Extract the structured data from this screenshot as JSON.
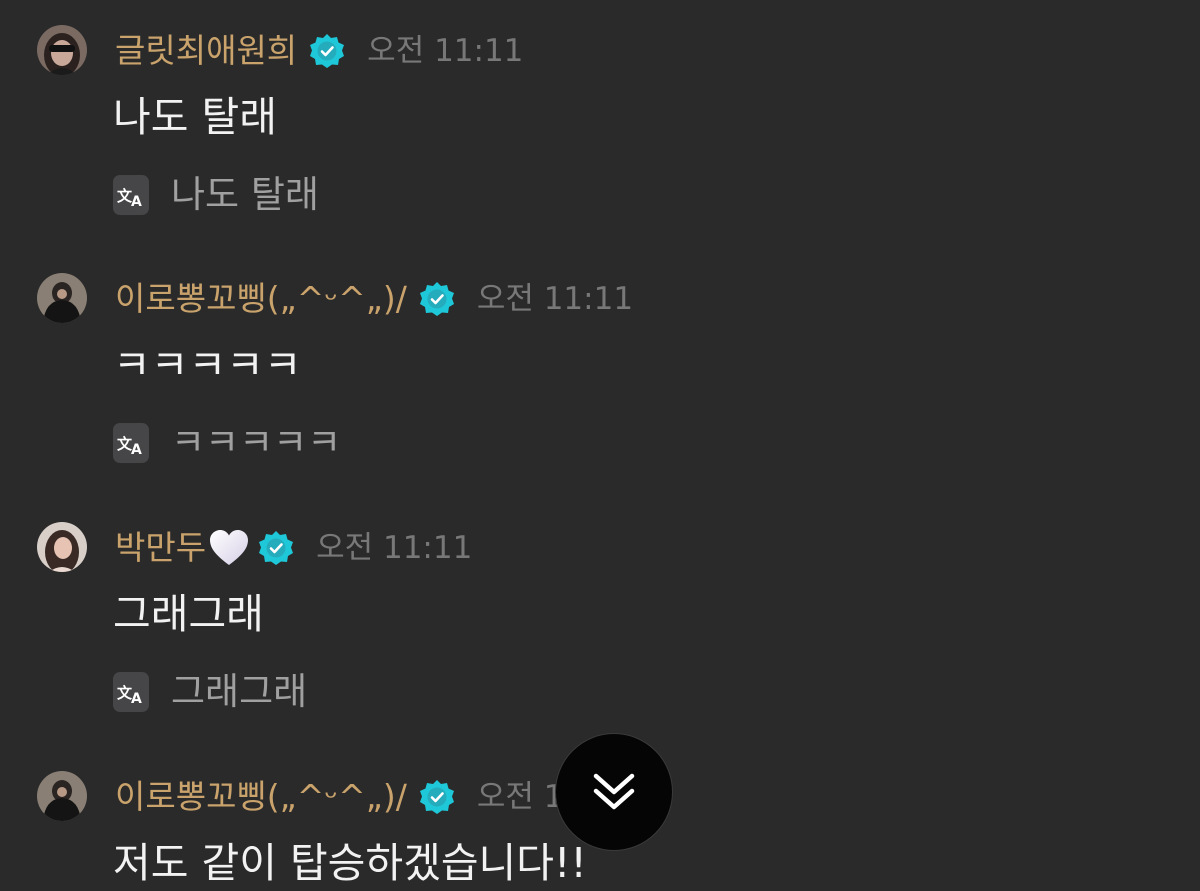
{
  "messages": [
    {
      "username": "글릿최애원희",
      "time": "오전 11:11",
      "text": "나도 탈래",
      "translation": "나도 탈래",
      "avatar": "avatar-sunglasses"
    },
    {
      "username": "이로뽕꼬삥(„^ᵕ^„)/",
      "time": "오전 11:11",
      "text": "ㅋㅋㅋㅋㅋ",
      "translation": "ㅋㅋㅋㅋㅋ",
      "avatar": "avatar-dark-outfit"
    },
    {
      "username": "박만두",
      "username_emoji": "heart-icon",
      "time": "오전 11:11",
      "text": "그래그래",
      "translation": "그래그래",
      "avatar": "avatar-portrait"
    },
    {
      "username": "이로뽕꼬삥(„^ᵕ^„)/",
      "time": "오전 11:11",
      "text": "저도 같이 탑승하겠습니다!!",
      "avatar": "avatar-dark-outfit"
    }
  ],
  "icons": {
    "verified": "verified-badge-icon",
    "translate": "translate-icon",
    "scroll": "chevron-double-down-icon"
  },
  "colors": {
    "background": "#2a2a2b",
    "username": "#c9a36b",
    "verified": "#1ec8d8",
    "message_text": "#f2f2f2",
    "timestamp": "#787878",
    "translation_text": "#a0a0a0"
  }
}
